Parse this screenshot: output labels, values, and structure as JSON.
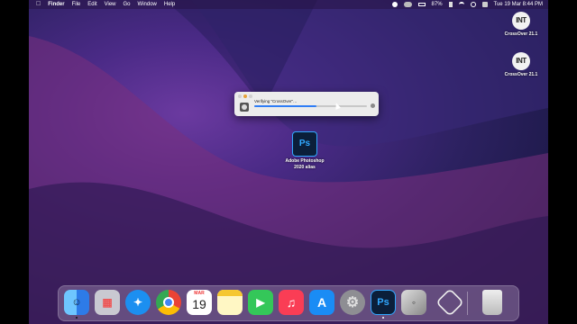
{
  "menubar": {
    "app": "Finder",
    "items": [
      "File",
      "Edit",
      "View",
      "Go",
      "Window",
      "Help"
    ],
    "battery": "87%",
    "datetime": "Tue 19 Mar  8:44 PM"
  },
  "desktop": {
    "crossover1_label": "CrossOver 21.1",
    "crossover2_label": "CrossOver 21.1",
    "crossover_logo": "INT",
    "photoshop_label_line1": "Adobe Photoshop",
    "photoshop_label_line2": "2020 alias",
    "photoshop_logo": "Ps"
  },
  "verify_dialog": {
    "message": "Verifying “CrossOver”…",
    "progress_fraction": 0.55
  },
  "dock": {
    "calendar_month": "MAR",
    "calendar_day": "19",
    "photoshop_glyph": "Ps",
    "icons": [
      "finder-icon",
      "launchpad-icon",
      "safari-icon",
      "chrome-icon",
      "calendar-icon",
      "notes-icon",
      "facetime-icon",
      "music-icon",
      "app-store-icon",
      "system-preferences-icon",
      "photoshop-icon",
      "crossover-dock-icon",
      "virtual-drive-icon",
      "trash-icon"
    ]
  }
}
